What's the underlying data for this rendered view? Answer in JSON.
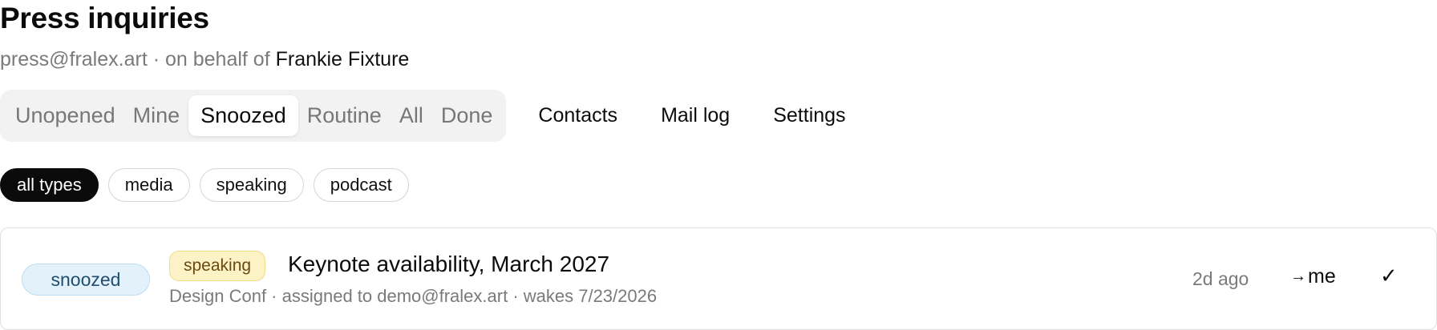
{
  "header": {
    "title": "Press inquiries",
    "address": "press@fralex.art",
    "behalf_prefix": " · on behalf of ",
    "owner": "Frankie Fixture"
  },
  "tabs": [
    "Unopened",
    "Mine",
    "Snoozed",
    "Routine",
    "All",
    "Done"
  ],
  "active_tab": "Snoozed",
  "nav": {
    "contacts": "Contacts",
    "mail_log": "Mail log",
    "settings": "Settings"
  },
  "filters": [
    "all types",
    "media",
    "speaking",
    "podcast"
  ],
  "active_filter": "all types",
  "inquiry": {
    "status": "snoozed",
    "type": "speaking",
    "subject": "Keynote availability, March 2027",
    "meta": "Design Conf · assigned to demo@fralex.art · wakes 7/23/2026",
    "age": "2d ago",
    "assign_arrow": "→",
    "assign_label": "me",
    "done_glyph": "✓"
  },
  "colors": {
    "status_badge_bg": "#e3f1fb",
    "type_badge_bg": "#fdf2c6",
    "active_chip_bg": "#0b0b0b"
  }
}
